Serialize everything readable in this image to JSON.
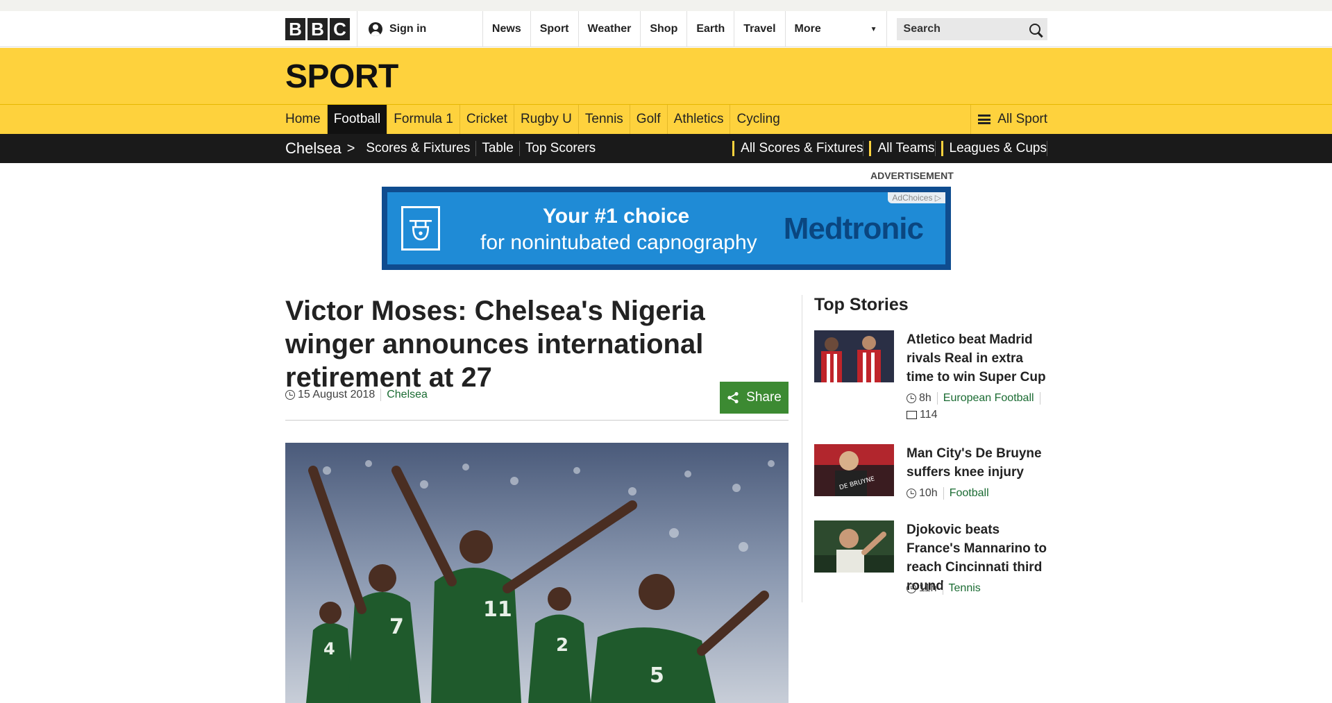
{
  "masthead": {
    "logo_letters": [
      "B",
      "B",
      "C"
    ],
    "signin_label": "Sign in",
    "nav": [
      "News",
      "Sport",
      "Weather",
      "Shop",
      "Earth",
      "Travel"
    ],
    "more_label": "More",
    "search_placeholder": "Search"
  },
  "sport": {
    "title": "SPORT",
    "nav": [
      "Home",
      "Football",
      "Formula 1",
      "Cricket",
      "Rugby U",
      "Tennis",
      "Golf",
      "Athletics",
      "Cycling"
    ],
    "active": "Football",
    "all_sport": "All Sport"
  },
  "team_nav": {
    "team": "Chelsea",
    "left_links": [
      "Scores & Fixtures",
      "Table",
      "Top Scorers"
    ],
    "right_links": [
      "All Scores & Fixtures",
      "All Teams",
      "Leagues & Cups"
    ]
  },
  "ad": {
    "label": "ADVERTISEMENT",
    "choices": "AdChoices",
    "line1": "Your #1 choice",
    "line2": "for nonintubated capnography",
    "brand": "Medtronic"
  },
  "article": {
    "headline": "Victor Moses: Chelsea's Nigeria winger announces international retirement at 27",
    "date": "15 August 2018",
    "section": "Chelsea",
    "share_label": "Share"
  },
  "top_stories": {
    "title": "Top Stories",
    "items": [
      {
        "title": "Atletico beat Madrid rivals Real in extra time to win Super Cup",
        "time": "8h",
        "section": "European Football",
        "comments": "114"
      },
      {
        "title": "Man City's De Bruyne suffers knee injury",
        "time": "10h",
        "section": "Football"
      },
      {
        "title": "Djokovic beats France's Mannarino to reach Cincinnati third round",
        "time": "11h",
        "section": "Tennis"
      }
    ]
  },
  "colors": {
    "sport_yellow": "#fed23d",
    "link_green": "#1a6b32",
    "share_green": "#3c8a32"
  }
}
